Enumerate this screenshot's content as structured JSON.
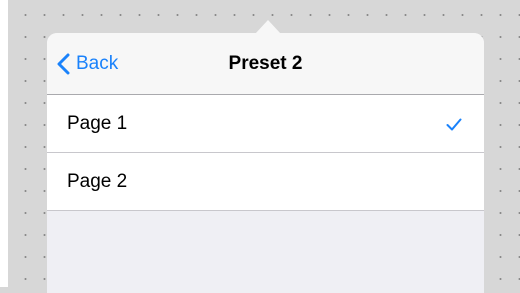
{
  "colors": {
    "accent": "#1a82fb",
    "canvas": "#d7d7d7",
    "navbar": "#f7f7f7",
    "grouped_background": "#efeff4"
  },
  "navbar": {
    "back_label": "Back",
    "back_icon": "chevron-left-icon",
    "title": "Preset 2"
  },
  "pages": [
    {
      "label": "Page 1",
      "selected": true,
      "icon": "checkmark-icon"
    },
    {
      "label": "Page 2",
      "selected": false
    }
  ]
}
